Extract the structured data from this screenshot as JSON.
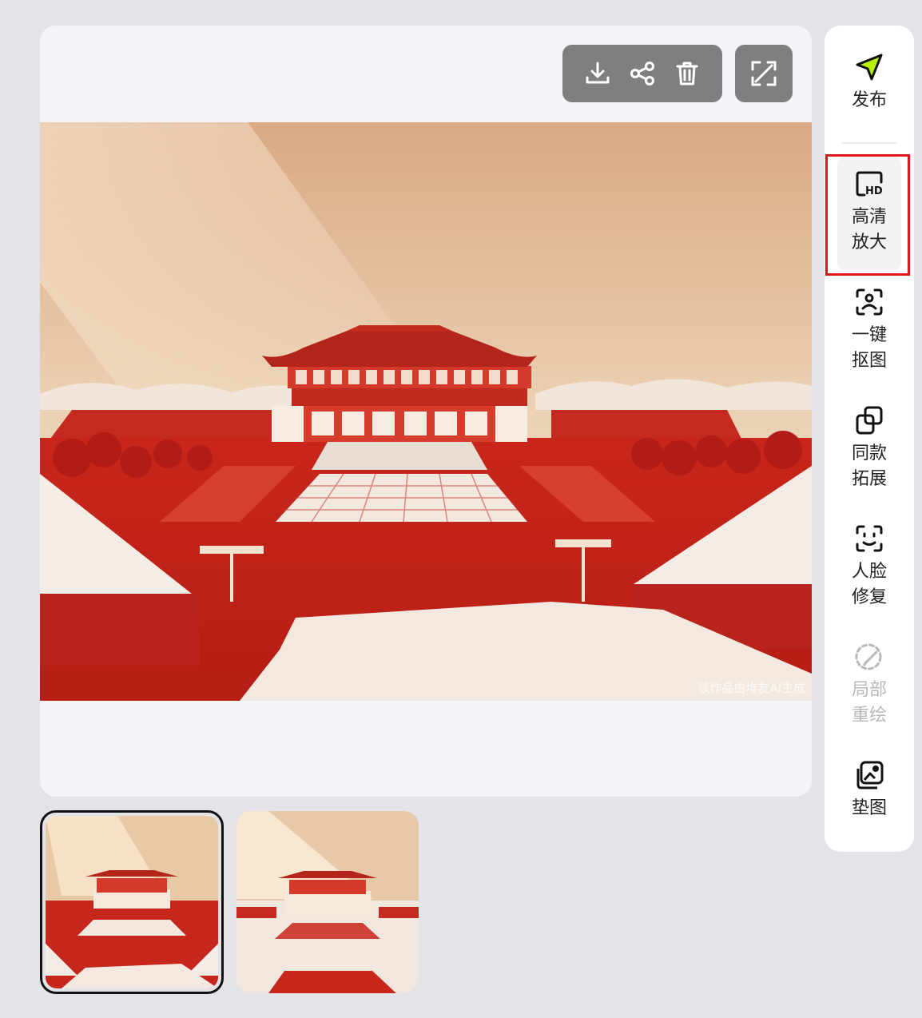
{
  "toolbar": {
    "download_icon": "download-icon",
    "share_icon": "share-icon",
    "delete_icon": "trash-icon",
    "expand_icon": "expand-icon"
  },
  "image": {
    "watermark": "该作品由堆友AI生成"
  },
  "sidebar": {
    "items": [
      {
        "icon": "send-icon",
        "label_lines": [
          "发布"
        ],
        "accent": "#b7f000"
      },
      {
        "icon": "hd-icon",
        "label_lines": [
          "高清",
          "放大"
        ],
        "highlighted": true
      },
      {
        "icon": "cutout-icon",
        "label_lines": [
          "一键",
          "抠图"
        ]
      },
      {
        "icon": "expand-similar-icon",
        "label_lines": [
          "同款",
          "拓展"
        ]
      },
      {
        "icon": "face-repair-icon",
        "label_lines": [
          "人脸",
          "修复"
        ]
      },
      {
        "icon": "inpaint-icon",
        "label_lines": [
          "局部",
          "重绘"
        ],
        "disabled": true
      },
      {
        "icon": "reference-image-icon",
        "label_lines": [
          "垫图"
        ]
      }
    ]
  },
  "colors": {
    "background": "#e4e3e8",
    "card": "#f4f5f9",
    "toolbar_bg": "#7f7f80",
    "highlight_border": "#e0151b",
    "palace_red": "#c7261c"
  }
}
